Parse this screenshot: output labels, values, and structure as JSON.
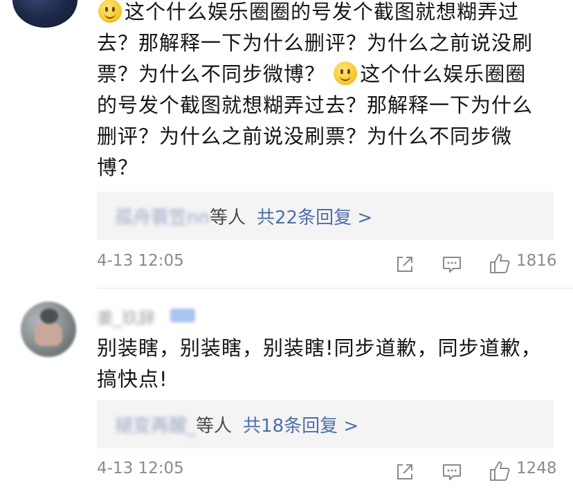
{
  "comments": [
    {
      "text_lines": [
        "这个什么娱乐圈圈的号发个截图就想糊弄过",
        "去？那解释一下为什么删评？为什么之前说没刷",
        "票？为什么不同步微博？",
        "这个什么娱乐圈圈",
        "的号发个截图就想糊弄过去？那解释一下为什么",
        "删评？为什么之前说没刷票？为什么不同步微",
        "博？"
      ],
      "reply_preview": {
        "names": "孤舟蓑笠nn",
        "others": "等人",
        "count": "共22条回复 >"
      },
      "timestamp": "4-13 12:05",
      "likes": "1816"
    },
    {
      "username": "姜_玖辞",
      "text_lines": [
        "别装瞎，别装瞎，别装瞎!同步道歉，同步道歉，",
        "搞快点!"
      ],
      "reply_preview": {
        "names": "褪变再醒_",
        "others": "等人",
        "count": "共18条回复 >"
      },
      "timestamp": "4-13 12:05",
      "likes": "1248"
    }
  ],
  "icons": [
    "share-icon",
    "comment-icon",
    "like-icon",
    "smile-emoji-icon"
  ],
  "colors": {
    "link": "#4d6fa9",
    "meta": "#8a8a8a",
    "reply_bg": "#f4f4f4"
  }
}
